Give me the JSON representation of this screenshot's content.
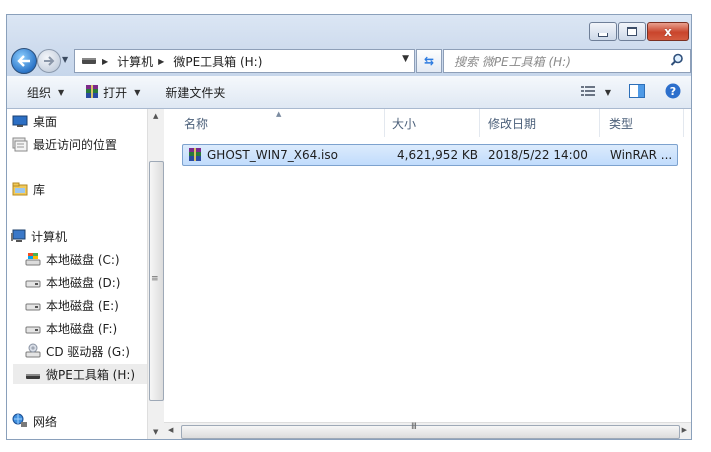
{
  "window": {
    "caption_buttons": [
      "minimize",
      "maximize",
      "close"
    ],
    "close_glyph": "x"
  },
  "address_bar": {
    "segments": [
      "计算机",
      "微PE工具箱 (H:)"
    ],
    "search_placeholder": "搜索 微PE工具箱 (H:)"
  },
  "toolbar": {
    "organize_label": "组织",
    "open_label": "打开",
    "new_folder_label": "新建文件夹"
  },
  "nav_pane": {
    "items": [
      {
        "label": "桌面",
        "icon": "desktop-icon"
      },
      {
        "label": "最近访问的位置",
        "icon": "recent-places-icon"
      },
      {
        "label": "库",
        "icon": "library-icon"
      },
      {
        "label": "计算机",
        "icon": "computer-icon"
      },
      {
        "label": "本地磁盘 (C:)",
        "icon": "system-drive-icon"
      },
      {
        "label": "本地磁盘 (D:)",
        "icon": "drive-icon"
      },
      {
        "label": "本地磁盘 (E:)",
        "icon": "drive-icon"
      },
      {
        "label": "本地磁盘 (F:)",
        "icon": "drive-icon"
      },
      {
        "label": "CD 驱动器 (G:)",
        "icon": "cd-drive-icon"
      },
      {
        "label": "微PE工具箱 (H:)",
        "icon": "usb-drive-icon"
      },
      {
        "label": "网络",
        "icon": "network-icon"
      }
    ],
    "selected": "微PE工具箱 (H:)"
  },
  "file_list": {
    "columns": [
      "名称",
      "大小",
      "修改日期",
      "类型"
    ],
    "rows": [
      {
        "name": "GHOST_WIN7_X64.iso",
        "size": "4,621,952 KB",
        "modified": "2018/5/22 14:00",
        "type": "WinRAR ..."
      }
    ]
  },
  "scrollbars": {
    "grip_vertical": "≡",
    "grip_horizontal": "III"
  },
  "colors": {
    "selection_bg": "#cce4fd",
    "selection_border": "#7da2ce",
    "close_button": "#c9452c",
    "title_gradient_top": "#dbe6f4"
  }
}
